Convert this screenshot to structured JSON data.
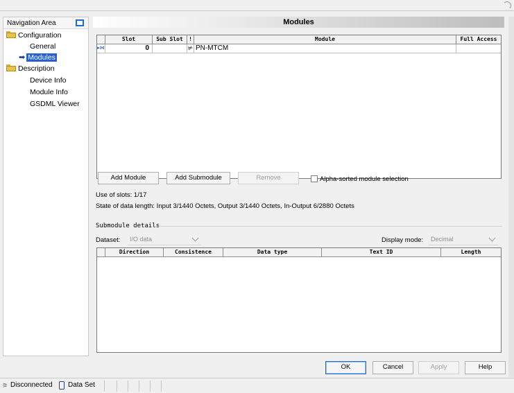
{
  "nav": {
    "title": "Navigation Area",
    "items": [
      {
        "label": "Configuration",
        "level": 0,
        "icon": "folder-icon"
      },
      {
        "label": "General",
        "level": 1
      },
      {
        "label": "Modules",
        "level": 1,
        "selected": true
      },
      {
        "label": "Description",
        "level": 0,
        "icon": "folder-icon"
      },
      {
        "label": "Device Info",
        "level": 1
      },
      {
        "label": "Module Info",
        "level": 1
      },
      {
        "label": "GSDML Viewer",
        "level": 1
      }
    ]
  },
  "modules": {
    "title": "Modules",
    "columns": [
      "Slot",
      "Sub Slot",
      "!",
      "Module",
      "Full Access"
    ],
    "rows": [
      {
        "slot": "0",
        "subslot": "",
        "flag": "⊭",
        "module": "PN-MTCM",
        "full_access": ""
      }
    ]
  },
  "buttons": {
    "add_module": "Add Module",
    "add_submodule": "Add Submodule",
    "remove": "Remove",
    "alpha_sorted": "Alpha-sorted module selection"
  },
  "info": {
    "use_of_slots": "Use of slots: 1/17",
    "state_of_data": "State of data length: Input 3/1440 Octets, Output 3/1440 Octets, In-Output 6/2880 Octets"
  },
  "submodule": {
    "section_title": "Submodule details",
    "dataset_label": "Dataset:",
    "dataset_value": "I/O data",
    "display_mode_label": "Display mode:",
    "display_mode_value": "Decimal",
    "columns": [
      "Direction",
      "Consistence",
      "Data type",
      "Text ID",
      "Length"
    ]
  },
  "footer": {
    "ok": "OK",
    "cancel": "Cancel",
    "apply": "Apply",
    "help": "Help"
  },
  "status": {
    "connection": "Disconnected",
    "dataset": "Data Set"
  },
  "colors": {
    "selection": "#2a5fd0",
    "accent": "#1e6ccd"
  }
}
